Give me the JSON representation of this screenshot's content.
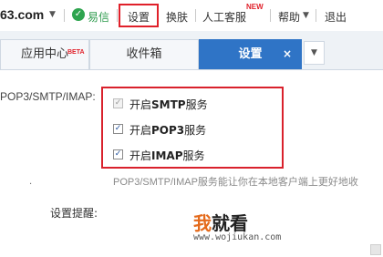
{
  "topbar": {
    "brand": "63.com",
    "brand_caret": "▼",
    "yixin": "易信",
    "settings": "设置",
    "skin": "换肤",
    "service": "人工客服",
    "service_badge": "NEW",
    "help": "帮助",
    "help_caret": "▼",
    "logout": "退出"
  },
  "tabs": [
    {
      "label": "应用中心",
      "badge": "BETA"
    },
    {
      "label": "收件箱"
    },
    {
      "label": "设置",
      "close": "×"
    }
  ],
  "tab_dropdown": "▼",
  "form": {
    "protocol_label": "POP3/SMTP/IMAP:",
    "options": [
      {
        "prefix": "开启",
        "protocol": "SMTP",
        "suffix": "服务",
        "checked": true,
        "disabled": true
      },
      {
        "prefix": "开启",
        "protocol": "POP3",
        "suffix": "服务",
        "checked": true,
        "disabled": false
      },
      {
        "prefix": "开启",
        "protocol": "IMAP",
        "suffix": "服务",
        "checked": true,
        "disabled": false
      }
    ],
    "bullet": "·",
    "description": "POP3/SMTP/IMAP服务能让你在本地客户端上更好地收",
    "reminder_label": "设置提醒:"
  },
  "watermark": {
    "wo": "我",
    "rest": "就看",
    "url": "www.wojiukan.com"
  },
  "colors": {
    "accent": "#2f74c6",
    "highlight": "#e0202a",
    "yixin": "#2e9b4e"
  }
}
